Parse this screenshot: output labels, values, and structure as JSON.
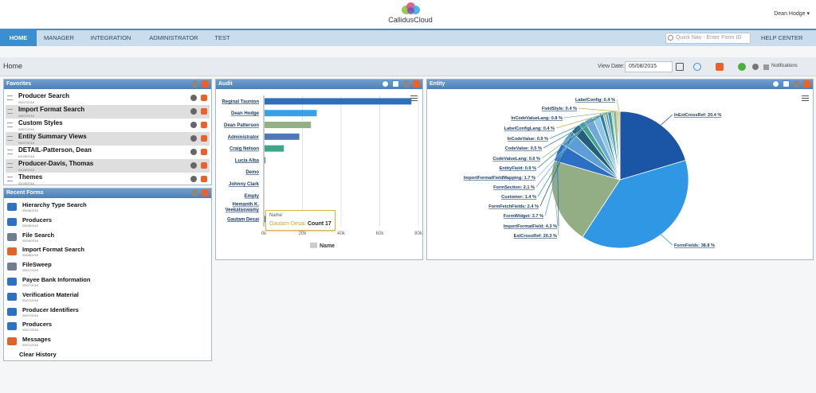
{
  "app": {
    "brand": "CallidusCloud",
    "user_menu": "Dean Hodge ▾"
  },
  "nav": {
    "tabs": [
      "HOME",
      "MANAGER",
      "INTEGRATION",
      "ADMINISTRATOR",
      "TEST"
    ],
    "active": "HOME",
    "quick_nav_placeholder": "Quick Nav - Enter Form ID",
    "help": "HELP CENTER"
  },
  "page": {
    "title": "Home",
    "view_date_label": "View Date:",
    "view_date": "05/08/2015",
    "notifications": "Notifications"
  },
  "favorites": {
    "title": "Favorites",
    "items": [
      {
        "label": "Producer Search",
        "sub": "05/07/2016"
      },
      {
        "label": "Import Format Search",
        "sub": "05/07/2016"
      },
      {
        "label": "Custom Styles",
        "sub": "05/07/2016"
      },
      {
        "label": "Entity Summary Views",
        "sub": "05/07/2016"
      },
      {
        "label": "DETAIL-Patterson, Dean",
        "sub": "04/28/2016"
      },
      {
        "label": "Producer-Davis, Thomas",
        "sub": "04/28/2016"
      },
      {
        "label": "Themes",
        "sub": "04/28/2016"
      }
    ]
  },
  "recent_forms": {
    "title": "Recent Forms",
    "items": [
      {
        "label": "Hierarchy Type Search",
        "sub": "05/08/2016",
        "icon": "folder-icon"
      },
      {
        "label": "Producers",
        "sub": "05/08/2016",
        "icon": "folder-icon"
      },
      {
        "label": "File Search",
        "sub": "05/08/2016",
        "icon": "tools-icon"
      },
      {
        "label": "Import Format Search",
        "sub": "05/08/2016",
        "icon": "toolbox-icon"
      },
      {
        "label": "FileSweep",
        "sub": "05/07/2016",
        "icon": "tools-icon"
      },
      {
        "label": "Payee Bank Information",
        "sub": "05/07/2016",
        "icon": "folder-icon"
      },
      {
        "label": "Verification Material",
        "sub": "05/07/2016",
        "icon": "folder-icon"
      },
      {
        "label": "Producer Identifiers",
        "sub": "05/07/2016",
        "icon": "folder-icon"
      },
      {
        "label": "Producers",
        "sub": "05/07/2016",
        "icon": "folder-icon"
      },
      {
        "label": "Messages",
        "sub": "05/07/2016",
        "icon": "toolbox-icon"
      }
    ],
    "clear": "Clear History"
  },
  "audit": {
    "title": "Audit",
    "tooltip": {
      "header": "Name",
      "name": "Gautam Desai:",
      "count_label": "Count",
      "count": "17"
    }
  },
  "entity": {
    "title": "Entity"
  },
  "colors": {
    "nav_active": "#3a8fd0",
    "panel_header": "#5b8cc4",
    "close_orange": "#e8622c"
  },
  "chart_data": [
    {
      "type": "bar",
      "orientation": "horizontal",
      "title": "",
      "categories": [
        "Reginal Taunton",
        "Dean Hodge",
        "Dean Patterson",
        "Administrator",
        "Craig Nelson",
        "Lucia Alba",
        "Demo",
        "Johnny Clark",
        "Empty",
        "Hemanth K. Veekataswamy",
        "Gautam Desai"
      ],
      "values": [
        76000,
        27000,
        24000,
        18000,
        10000,
        200,
        0,
        0,
        0,
        0,
        17
      ],
      "colors": [
        "#2d6fb8",
        "#3aa0e6",
        "#94b185",
        "#4f78b9",
        "#3da58a",
        "#2d6fb8",
        "#2d6fb8",
        "#2d6fb8",
        "#2d6fb8",
        "#2d6fb8",
        "#2d6fb8"
      ],
      "xlim": [
        0,
        80000
      ],
      "xticks": [
        "0k",
        "20k",
        "40k",
        "60k",
        "80k"
      ],
      "legend": [
        "Name"
      ],
      "legend_position": "bottom"
    },
    {
      "type": "pie",
      "slices": [
        {
          "label": "InExtCrossRef",
          "value": 20.4,
          "text": "InExtCrossRef: 20.4 %",
          "color": "#1b55a5"
        },
        {
          "label": "FormFields",
          "value": 38.8,
          "text": "FormFields: 38.8 %",
          "color": "#2f97e4"
        },
        {
          "label": "ExtCrossRef",
          "value": 20.3,
          "text": "ExtCrossRef: 20.3 %",
          "color": "#93ae84"
        },
        {
          "label": "ImportFormatField",
          "value": 4.3,
          "text": "ImportFormatField: 4.3 %",
          "color": "#2d6fc4"
        },
        {
          "label": "FormWidget",
          "value": 3.7,
          "text": "FormWidget: 3.7 %",
          "color": "#5d9ed6"
        },
        {
          "label": "FormFetchFields",
          "value": 2.4,
          "text": "FormFetchFields: 2.4 %",
          "color": "#235e7e"
        },
        {
          "label": "Customer",
          "value": 1.4,
          "text": "Customer: 1.4 %",
          "color": "#41a48a"
        },
        {
          "label": "FormSection",
          "value": 2.1,
          "text": "FormSection: 2.1 %",
          "color": "#6fa9dc"
        },
        {
          "label": "ImportFormatFieldMapping",
          "value": 1.7,
          "text": "ImportFormatFieldMapping: 1.7 %",
          "color": "#8ec5e8"
        },
        {
          "label": "EntityField",
          "value": 0.9,
          "text": "EntityField: 0.9 %",
          "color": "#2b7bb9"
        },
        {
          "label": "CodeValueLang",
          "value": 0.6,
          "text": "CodeValueLang: 0.6 %",
          "color": "#a2c08f"
        },
        {
          "label": "CodeValue",
          "value": 0.5,
          "text": "CodeValue: 0.5 %",
          "color": "#4a7fbf"
        },
        {
          "label": "InCodeValue",
          "value": 0.9,
          "text": "InCodeValue: 0.9 %",
          "color": "#2fa0b6"
        },
        {
          "label": "LabelConfigLang",
          "value": 0.4,
          "text": "LabelConfigLang: 0.4 %",
          "color": "#c9b24a"
        },
        {
          "label": "InCodeValueLang",
          "value": 0.8,
          "text": "InCodeValueLang: 0.8 %",
          "color": "#7fb6a5"
        },
        {
          "label": "FieldStyle",
          "value": 0.4,
          "text": "FieldStyle: 0.4 %",
          "color": "#d1a83c"
        },
        {
          "label": "LabelConfig",
          "value": 0.4,
          "text": "LabelConfig: 0.4 %",
          "color": "#b9c86a"
        }
      ]
    }
  ]
}
